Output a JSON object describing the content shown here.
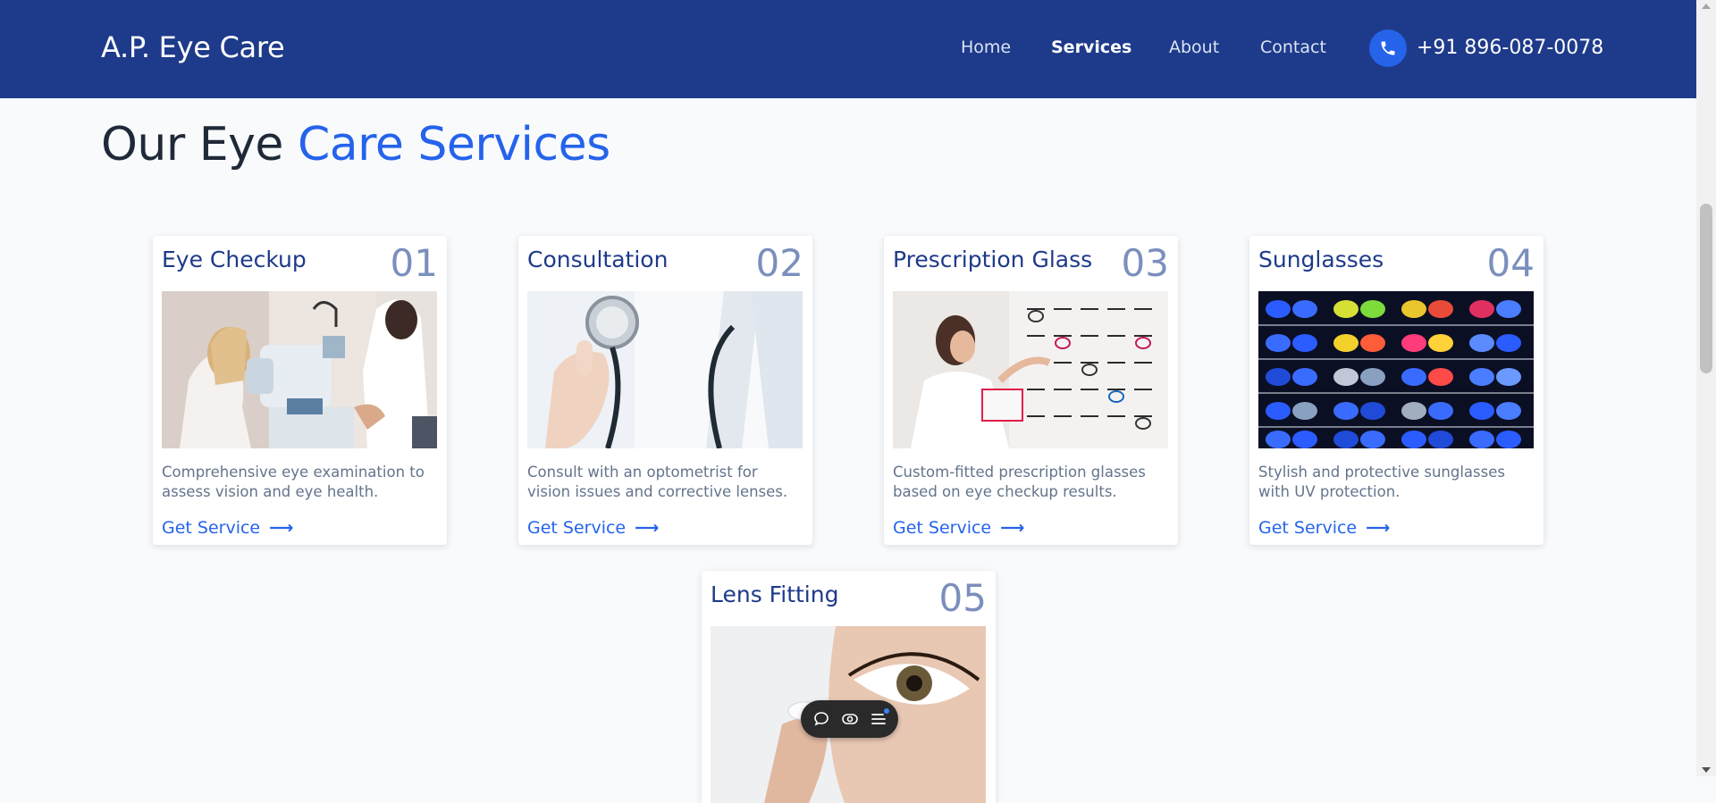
{
  "brand": {
    "name": "A.P. Eye Care"
  },
  "nav": {
    "items": [
      {
        "label": "Home",
        "active": false
      },
      {
        "label": "Services",
        "active": true
      },
      {
        "label": "About",
        "active": false
      },
      {
        "label": "Contact",
        "active": false
      }
    ],
    "phone": "+91 896-087-0078",
    "phone_icon": "phone-icon"
  },
  "section": {
    "title_part1": "Our Eye ",
    "title_part2": "Care Services"
  },
  "services": [
    {
      "title": "Eye Checkup",
      "number": "01",
      "description": "Comprehensive eye examination to assess vision and eye health.",
      "link_label": "Get Service",
      "image": "eye-checkup-photo"
    },
    {
      "title": "Consultation",
      "number": "02",
      "description": "Consult with an optometrist for vision issues and corrective lenses.",
      "link_label": "Get Service",
      "image": "stethoscope-photo"
    },
    {
      "title": "Prescription Glass",
      "number": "03",
      "description": "Custom-fitted prescription glasses based on eye checkup results.",
      "link_label": "Get Service",
      "image": "eyewear-store-photo"
    },
    {
      "title": "Sunglasses",
      "number": "04",
      "description": "Stylish and protective sunglasses with UV protection.",
      "link_label": "Get Service",
      "image": "sunglasses-display-photo"
    },
    {
      "title": "Lens Fitting",
      "number": "05",
      "image": "contact-lens-photo"
    }
  ],
  "colors": {
    "navbar": "#1e3a8a",
    "accent": "#2563eb",
    "page_background": "#f8fafc",
    "card_title": "#1e3a8a",
    "card_number": "#7b8fbd"
  },
  "toolbar": {
    "icons": [
      "chat-bubble-icon",
      "eye-toggle-icon",
      "menu-lines-icon"
    ]
  }
}
